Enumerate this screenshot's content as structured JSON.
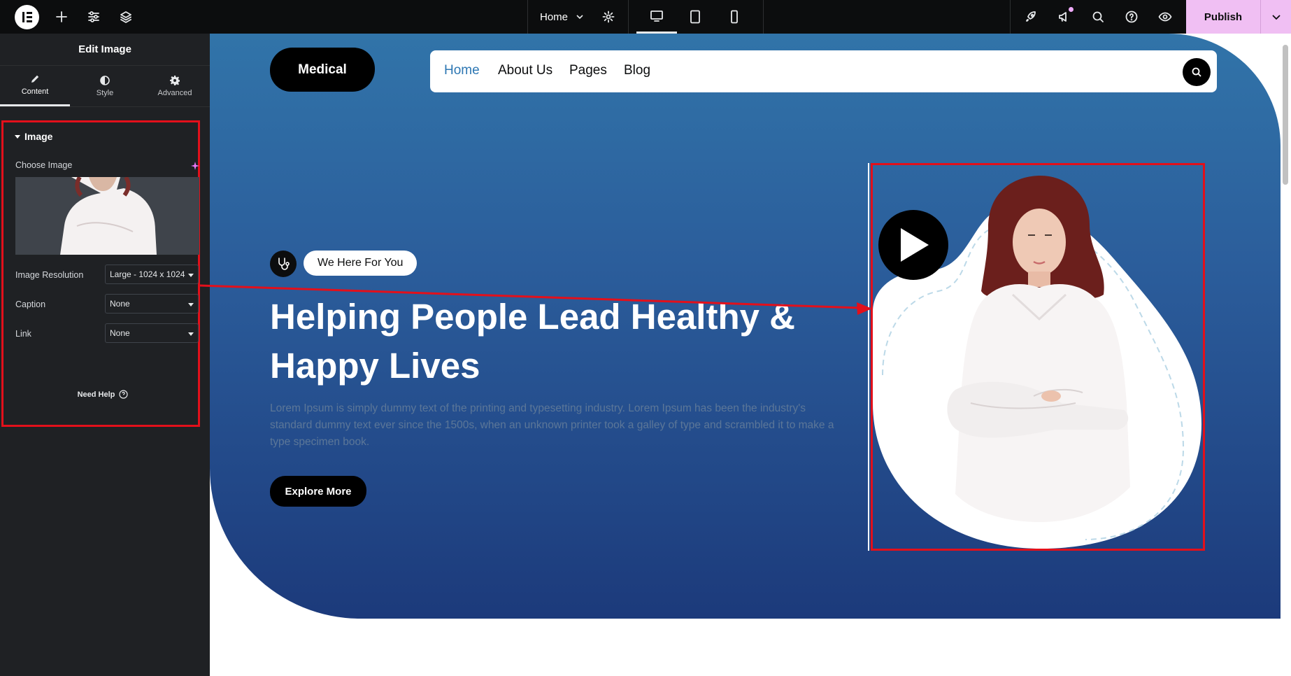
{
  "topbar": {
    "page_name": "Home",
    "publish_label": "Publish"
  },
  "panel": {
    "title": "Edit Image",
    "tabs": [
      {
        "label": "Content",
        "icon": "pencil-icon"
      },
      {
        "label": "Style",
        "icon": "half-circle-icon"
      },
      {
        "label": "Advanced",
        "icon": "gear-icon"
      }
    ],
    "section_title": "Image",
    "choose_image_label": "Choose Image",
    "resolution_label": "Image Resolution",
    "resolution_value": "Large - 1024 x 1024",
    "caption_label": "Caption",
    "caption_value": "None",
    "link_label": "Link",
    "link_value": "None",
    "need_help": "Need Help"
  },
  "site": {
    "brand": "Medical",
    "nav": [
      "Home",
      "About Us",
      "Pages",
      "Blog"
    ],
    "badge": "We Here For You",
    "title": "Helping People Lead Healthy & Happy Lives",
    "text": "Lorem Ipsum is simply dummy text of the printing and typesetting industry. Lorem Ipsum has been the industry's standard dummy text ever since the 1500s, when an unknown printer took a galley of type and scrambled it to make a type specimen book.",
    "cta": "Explore More"
  },
  "colors": {
    "accent_publish": "#f0bff3",
    "highlight": "#e2101b",
    "nav_active": "#2d77b3",
    "hero_top": "#3174a9",
    "hero_bottom": "#1c3a7b"
  }
}
